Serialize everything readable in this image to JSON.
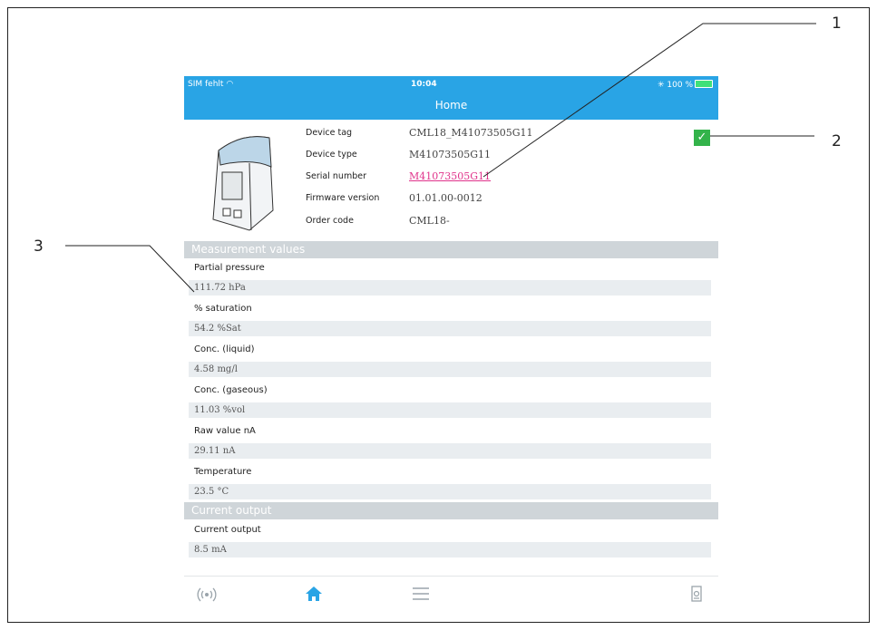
{
  "status_bar": {
    "carrier": "SIM fehlt",
    "time": "10:04",
    "battery": "100 %"
  },
  "nav": {
    "title": "Home"
  },
  "device": {
    "fields": [
      {
        "label": "Device tag",
        "value": "CML18_M41073505G11"
      },
      {
        "label": "Device type",
        "value": "M41073505G11"
      },
      {
        "label": "Serial number",
        "value": "M41073505G11"
      },
      {
        "label": "Firmware version",
        "value": "01.01.00-0012"
      },
      {
        "label": "Order code",
        "value": "CML18-"
      }
    ]
  },
  "sections": {
    "measurement": "Measurement values",
    "current": "Current output"
  },
  "measurements": [
    {
      "label": "Partial pressure",
      "value": "111.72 hPa"
    },
    {
      "label": "% saturation",
      "value": "54.2 %Sat"
    },
    {
      "label": "Conc. (liquid)",
      "value": "4.58 mg/l"
    },
    {
      "label": "Conc. (gaseous)",
      "value": "11.03 %vol"
    },
    {
      "label": "Raw value nA",
      "value": "29.11 nA"
    },
    {
      "label": "Temperature",
      "value": "23.5 °C"
    }
  ],
  "current_output": {
    "label": "Current output",
    "value": "8.5 mA"
  },
  "callouts": {
    "one": "1",
    "two": "2",
    "three": "3"
  },
  "colors": {
    "accent": "#29a4e5",
    "link": "#e0338b",
    "ok": "#33b34a",
    "section": "#cfd5d9",
    "row": "#e9edf0"
  },
  "icons": {
    "tabs": [
      "sensor-icon",
      "home-icon",
      "menu-icon",
      "device-icon"
    ],
    "status": "checkmark-icon"
  }
}
